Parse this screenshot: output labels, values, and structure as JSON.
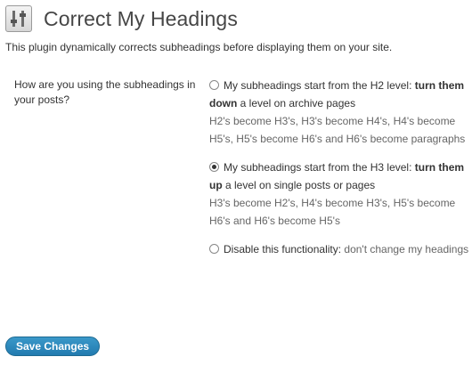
{
  "header": {
    "icon": "settings-sliders-icon",
    "title": "Correct My Headings"
  },
  "intro": "This plugin dynamically corrects subheadings before displaying them on your site.",
  "field": {
    "label": "How are you using the subheadings in your posts?"
  },
  "options": [
    {
      "checked": false,
      "main": "My subheadings start from the H2 level: ",
      "strong": "turn them down",
      "after": " a level on archive pages",
      "desc": "H2's become H3's, H3's become H4's, H4's become H5's, H5's become H6's and H6's become paragraphs"
    },
    {
      "checked": true,
      "main": "My subheadings start from the H3 level: ",
      "strong": "turn them up",
      "after": " a level on single posts or pages",
      "desc": "H3's become H2's, H4's become H3's, H5's become H6's and H6's become H5's"
    },
    {
      "checked": false,
      "main": "Disable this functionality",
      "strong": "",
      "after": ": ",
      "desc": "don't change my headings"
    }
  ],
  "save_button": "Save Changes",
  "colors": {
    "button_top": "#3a98c9",
    "button_bottom": "#227bb0",
    "desc_text": "#666666",
    "title_text": "#464646"
  }
}
